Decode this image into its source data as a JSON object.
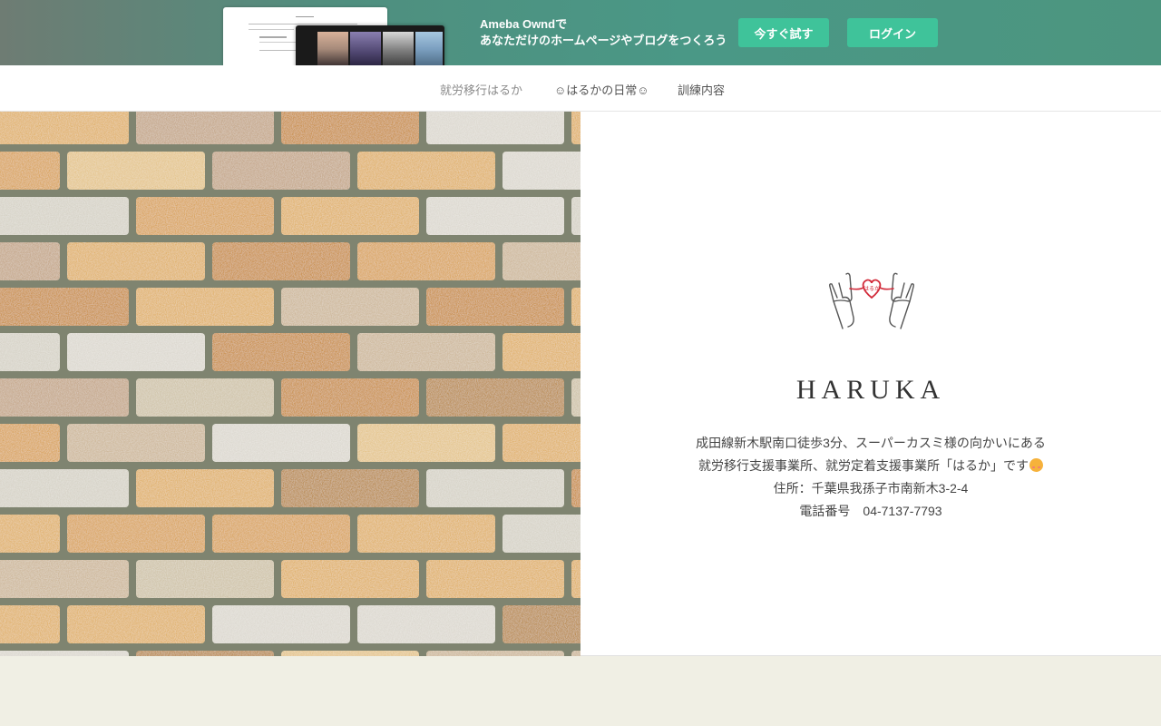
{
  "banner": {
    "brand_line": "Ameba Owndで",
    "tagline": "あなただけのホームページやブログをつくろう",
    "try_button": "今すぐ試す",
    "login_button": "ログイン"
  },
  "nav": {
    "items": [
      {
        "label": "就労移行はるか"
      },
      {
        "label": "☺はるかの日常☺"
      },
      {
        "label": "訓練内容"
      }
    ]
  },
  "hero": {
    "logo_text": "はるか",
    "title": "HARUKA",
    "desc_line1": "成田線新木駅南口徒歩3分、スーパーカスミ様の向かいにある",
    "desc_line2": "就労移行支援事業所、就労定着支援事業所「はるか」です",
    "desc_line3": "住所：千葉県我孫子市南新木3-2-4",
    "desc_line4": "電話番号　04-7137-7793"
  },
  "colors": {
    "banner_green": "#4a9886",
    "button_green": "#3fc39a",
    "footer_bg": "#f0efe4",
    "heart_red": "#d22b3a"
  }
}
